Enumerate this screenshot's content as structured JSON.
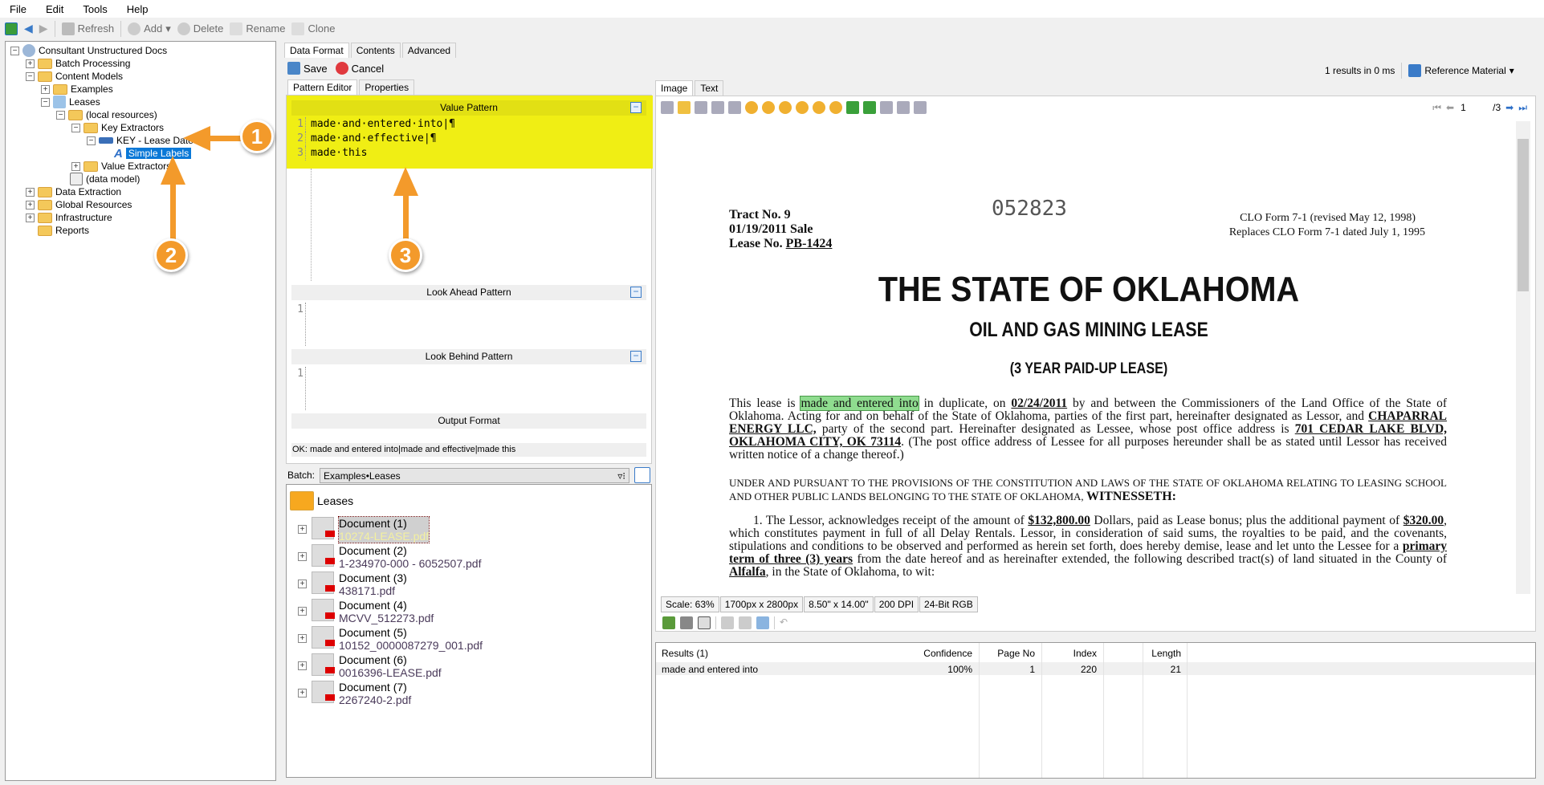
{
  "menu": [
    "File",
    "Edit",
    "Tools",
    "Help"
  ],
  "toolbar": {
    "refresh": "Refresh",
    "add": "Add",
    "delete": "Delete",
    "rename": "Rename",
    "clone": "Clone"
  },
  "tree": [
    {
      "label": "Consultant Unstructured Docs"
    },
    {
      "label": "Batch Processing"
    },
    {
      "label": "Content Models"
    },
    {
      "label": "Examples"
    },
    {
      "label": "Leases"
    },
    {
      "label": "(local resources)"
    },
    {
      "label": "Key Extractors"
    },
    {
      "label": "KEY - Lease Date"
    },
    {
      "label": "Simple Labels"
    },
    {
      "label": "Value Extractors"
    },
    {
      "label": "(data model)"
    },
    {
      "label": "Data Extraction"
    },
    {
      "label": "Global Resources"
    },
    {
      "label": "Infrastructure"
    },
    {
      "label": "Reports"
    }
  ],
  "main_tabs": [
    "Data Format",
    "Contents",
    "Advanced"
  ],
  "actions": {
    "save": "Save",
    "cancel": "Cancel"
  },
  "editor_tabs": [
    "Pattern Editor",
    "Properties"
  ],
  "sections": {
    "value": "Value Pattern",
    "ahead": "Look Ahead Pattern",
    "behind": "Look Behind Pattern",
    "output": "Output Format"
  },
  "value_lines": [
    {
      "n": "1",
      "t": "made·and·entered·into|¶"
    },
    {
      "n": "2",
      "t": "made·and·effective|¶"
    },
    {
      "n": "3",
      "t": "made·this"
    }
  ],
  "ahead_line": "1",
  "behind_line": "1",
  "status": "OK: made and entered into|made and effective|made this",
  "batch": {
    "label": "Batch:",
    "value": "Examples•Leases"
  },
  "folder": "Leases",
  "documents": [
    {
      "name": "Document (1)",
      "file": "10274-LEASE.pdf"
    },
    {
      "name": "Document (2)",
      "file": "1-234970-000 - 6052507.pdf"
    },
    {
      "name": "Document (3)",
      "file": "438171.pdf"
    },
    {
      "name": "Document (4)",
      "file": "MCVV_512273.pdf"
    },
    {
      "name": "Document (5)",
      "file": "10152_0000087279_001.pdf"
    },
    {
      "name": "Document (6)",
      "file": "0016396-LEASE.pdf"
    },
    {
      "name": "Document (7)",
      "file": "2267240-2.pdf"
    }
  ],
  "results_summary": "1 results in 0 ms",
  "reference": "Reference Material",
  "viewer_tabs": [
    "Image",
    "Text"
  ],
  "pager": {
    "page": "1",
    "total": "/3"
  },
  "page": {
    "tract": "Tract No. 9",
    "sale": "01/19/2011 Sale",
    "lease_label": "Lease No. ",
    "lease_no": "PB-1424",
    "stamp": "052823",
    "form1": "CLO Form 7-1 (revised May 12, 1998)",
    "form2": "Replaces CLO Form 7-1 dated July 1, 1995",
    "title": "THE STATE OF OKLAHOMA",
    "subtitle": "OIL AND GAS MINING LEASE",
    "term": "(3 YEAR PAID-UP LEASE)",
    "p1a": "This lease is ",
    "p1hl": "made and entered into",
    "p1b": " in duplicate, on ",
    "p1date": "02/24/2011",
    "p1c": " by and between the Commissioners of the Land Office of the State of Oklahoma. Acting for and on behalf of the State of Oklahoma, parties of the first part, hereinafter designated as Lessor, and ",
    "p1lessee": "CHAPARRAL ENERGY LLC,",
    "p1d": " party of the second part. Hereinafter designated as Lessee, whose post office address is ",
    "p1addr": "701 CEDAR LAKE BLVD,  OKLAHOMA CITY, OK 73114",
    "p1e": ". (The post office address of Lessee for all purposes hereunder shall be as stated until Lessor has received written notice of a change thereof.)",
    "p2": "UNDER AND PURSUANT TO THE PROVISIONS OF THE CONSTITUTION AND LAWS OF THE STATE OF OKLAHOMA RELATING TO LEASING SCHOOL AND OTHER PUBLIC LANDS BELONGING TO THE STATE OF OKLAHOMA, ",
    "p2b": "WITNESSETH:",
    "p3a": "1.   The Lessor, acknowledges receipt of the amount of ",
    "p3amt": "$132,800.00",
    "p3b": " Dollars, paid as Lease bonus; plus the additional payment of ",
    "p3amt2": "$320.00",
    "p3c": ", which constitutes payment in full of all Delay Rentals.  Lessor, in consideration of said sums, the royalties to be paid, and the covenants, stipulations and conditions to be observed and performed as herein set forth, does hereby demise, lease and let unto the Lessee for a ",
    "p3term": "primary term of three (3) years",
    "p3d": " from the date hereof and as hereinafter extended, the following described tract(s) of land situated in the County of ",
    "p3county": "Alfalfa",
    "p3e": ", in the State of Oklahoma, to wit:"
  },
  "image_status": [
    "Scale: 63%",
    "1700px x 2800px",
    "8.50\" x 14.00\"",
    "200 DPI",
    "24-Bit RGB"
  ],
  "results": {
    "headers": [
      "Results (1)",
      "Confidence",
      "Page No",
      "Index",
      "Length"
    ],
    "row": [
      "made and entered into",
      "100%",
      "1",
      "220",
      "21"
    ]
  },
  "callouts": [
    "1",
    "2",
    "3"
  ],
  "colors": {
    "highlight": "#f0ee14",
    "accent": "#f39a2b",
    "selection": "#0a78d7",
    "match": "#8fdc8f"
  }
}
